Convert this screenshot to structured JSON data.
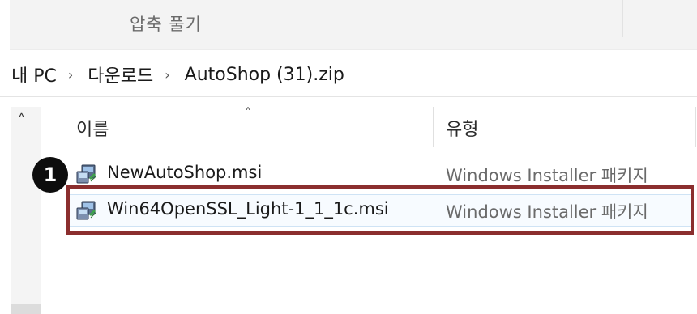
{
  "ribbon": {
    "extract_label": "압축 풀기"
  },
  "breadcrumb": {
    "items": [
      "내 PC",
      "다운로드",
      "AutoShop (31).zip"
    ],
    "separator": "›"
  },
  "columns": {
    "name": "이름",
    "type": "유형"
  },
  "files": [
    {
      "name": "NewAutoShop.msi",
      "type": "Windows Installer 패키지"
    },
    {
      "name": "Win64OpenSSL_Light-1_1_1c.msi",
      "type": "Windows Installer 패키지"
    }
  ],
  "annotation": {
    "step_number": "1",
    "highlight_color": "#8b2e2e"
  }
}
